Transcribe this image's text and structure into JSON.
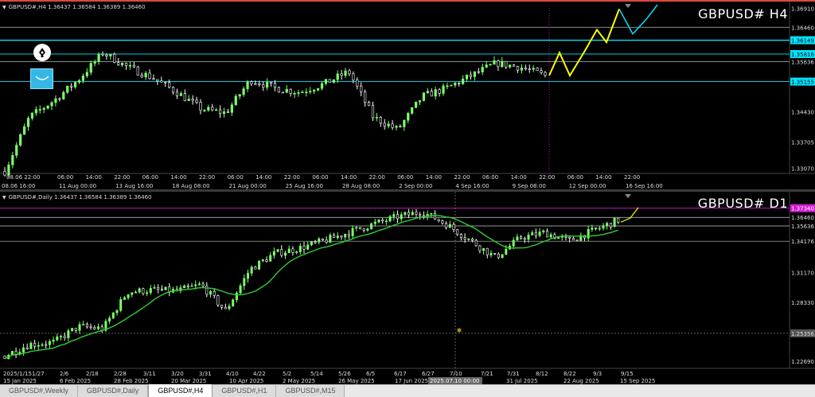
{
  "h4": {
    "header": "GBPUSD#,H4  1.36437 1.36584 1.36389 1.36460",
    "title": "GBPUSD# H4",
    "price_labels": [
      {
        "text": "1.36910",
        "price": 1.3691,
        "style": "plain"
      },
      {
        "text": "1.36460",
        "price": 1.3646,
        "style": "plain"
      },
      {
        "text": "1.36149",
        "price": 1.36149,
        "style": "cyan"
      },
      {
        "text": "1.35816",
        "price": 1.35816,
        "style": "cyan"
      },
      {
        "text": "1.35636",
        "price": 1.35636,
        "style": "plain"
      },
      {
        "text": "1.35155",
        "price": 1.35155,
        "style": "cyan"
      },
      {
        "text": "1.34430",
        "price": 1.3443,
        "style": "plain"
      },
      {
        "text": "1.33705",
        "price": 1.33705,
        "style": "plain"
      },
      {
        "text": "1.33070",
        "price": 1.3307,
        "style": "plain"
      }
    ],
    "time_labels": [
      "08.06 16:00",
      "08.06 22:00",
      "06:00",
      "14:00",
      "22:00",
      "06:00",
      "14:00",
      "22:00",
      "06:00",
      "14:00",
      "22:00",
      "06:00",
      "14:00",
      "22:00",
      "06:00",
      "14:00",
      "22:00",
      "06:00",
      "14:00",
      "22:00",
      "06:00",
      "14:00",
      "22:00"
    ],
    "bottom_dates": [
      "11 Aug 00:00",
      "13 Aug 16:00",
      "18 Aug 08:00",
      "21 Aug 00:00",
      "25 Aug 16:00",
      "28 Aug 08:00",
      "2 Sep 00:00",
      "4 Sep 16:00",
      "9 Sep 08:00",
      "12 Sep 00:00",
      "16 Sep 16:00"
    ],
    "icons": [
      "pen-icon",
      "smile-icon"
    ]
  },
  "d1": {
    "header": "GBPUSD#,Daily  1.36437 1.36584 1.36389 1.36460",
    "title": "GBPUSD# D1",
    "price_labels": [
      {
        "text": "1.37340",
        "price": 1.3734,
        "style": "magenta"
      },
      {
        "text": "1.36460",
        "price": 1.3646,
        "style": "plain"
      },
      {
        "text": "1.35636",
        "price": 1.35636,
        "style": "plain"
      },
      {
        "text": "1.34176",
        "price": 1.34176,
        "style": "plain"
      },
      {
        "text": "1.31170",
        "price": 1.3117,
        "style": "plain"
      },
      {
        "text": "1.28330",
        "price": 1.2833,
        "style": "plain"
      },
      {
        "text": "1.25356",
        "price": 1.25356,
        "style": "plain"
      },
      {
        "text": "1.22690",
        "price": 1.2269,
        "style": "plain"
      }
    ],
    "time_labels": [
      "2025/1/15",
      "1/27",
      "2/6",
      "2/18",
      "2/28",
      "3/11",
      "3/20",
      "3/31",
      "4/10",
      "4/22",
      "5/2",
      "5/14",
      "5/26",
      "6/5",
      "6/17",
      "6/27",
      "7/10",
      "7/21",
      "7/31",
      "8/12",
      "8/22",
      "9/3",
      "9/15"
    ],
    "bottom_dates": [
      "15 Jan 2025",
      "6 Feb 2025",
      "28 Feb 2025",
      "20 Mar 2025",
      "10 Apr 2025",
      "2 May 2025",
      "26 May 2025",
      "17 Jun 2025",
      "31 Jul 2025",
      "22 Aug 2025",
      "15 Sep 2025"
    ],
    "crosshair_label": "2025.07.10 00:00"
  },
  "colors": {
    "bull": "#7cff6b",
    "bear": "#ffffff",
    "cyan": "#00e5ff",
    "yellow": "#ffff00",
    "magenta": "#d11fd1",
    "ma": "#32cd32",
    "grid": "#444444"
  },
  "tabs": [
    {
      "label": "GBPUSD#,Weekly",
      "active": false
    },
    {
      "label": "GBPUSD#,Daily",
      "active": false
    },
    {
      "label": "GBPUSD#,H4",
      "active": true
    },
    {
      "label": "GBPUSD#,H1",
      "active": false
    },
    {
      "label": "GBPUSD#,M15",
      "active": false
    }
  ]
}
